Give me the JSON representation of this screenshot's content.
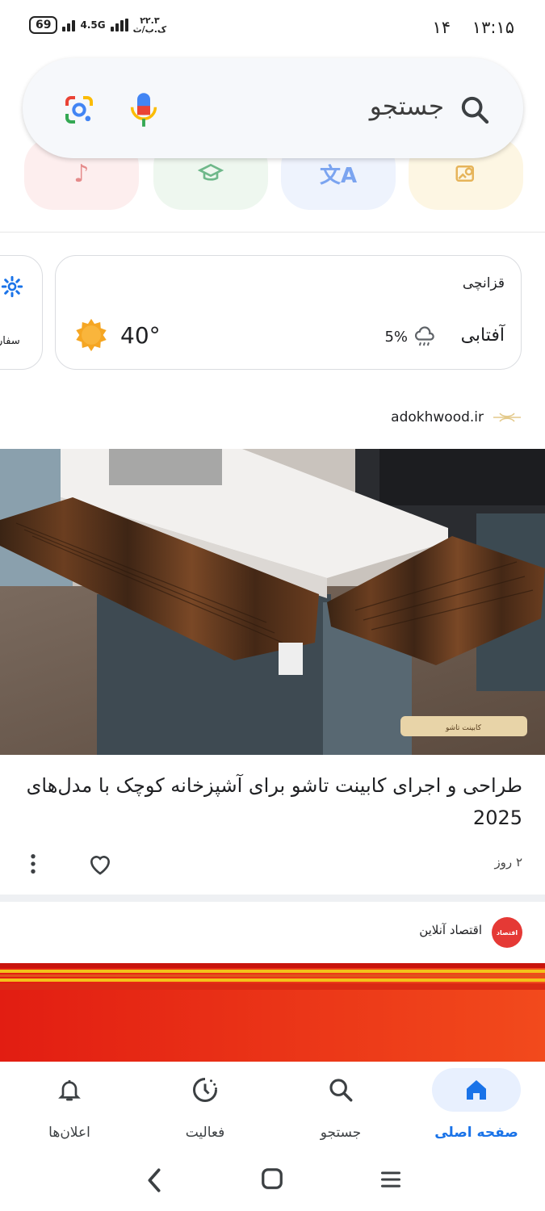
{
  "status_bar": {
    "time": "۱۳:۱۵",
    "date_num": "۱۴",
    "battery": "69",
    "network": "4.5G",
    "speed_top": "۲۲.۳",
    "speed_bottom": "ک.ب/ث"
  },
  "search": {
    "placeholder": "جستجو"
  },
  "weather": {
    "city": "قزانچی",
    "condition": "آفتابی",
    "rain_chance": "5%",
    "temperature": "40°",
    "side_card_label": "سفار"
  },
  "article1": {
    "source": "adokhwood.ir",
    "image_caption": "کابینت تاشو",
    "title": "طراحی و اجرای کابینت تاشو برای آشپزخانه کوچک با مدل‌های 2025",
    "time_ago": "۲ روز"
  },
  "article2": {
    "source": "اقتصاد آنلاین",
    "logo_text": "اقتصاد"
  },
  "bottom_nav": [
    {
      "label": "صفحه اصلی",
      "icon": "home-icon",
      "active": true
    },
    {
      "label": "جستجو",
      "icon": "search-icon",
      "active": false
    },
    {
      "label": "فعالیت",
      "icon": "activity-icon",
      "active": false
    },
    {
      "label": "اعلان‌ها",
      "icon": "bell-icon",
      "active": false
    }
  ],
  "colors": {
    "accent": "#1a73e8",
    "active_pill": "#e8f0fe",
    "sun": "#f5a623",
    "red_logo": "#e53935"
  }
}
